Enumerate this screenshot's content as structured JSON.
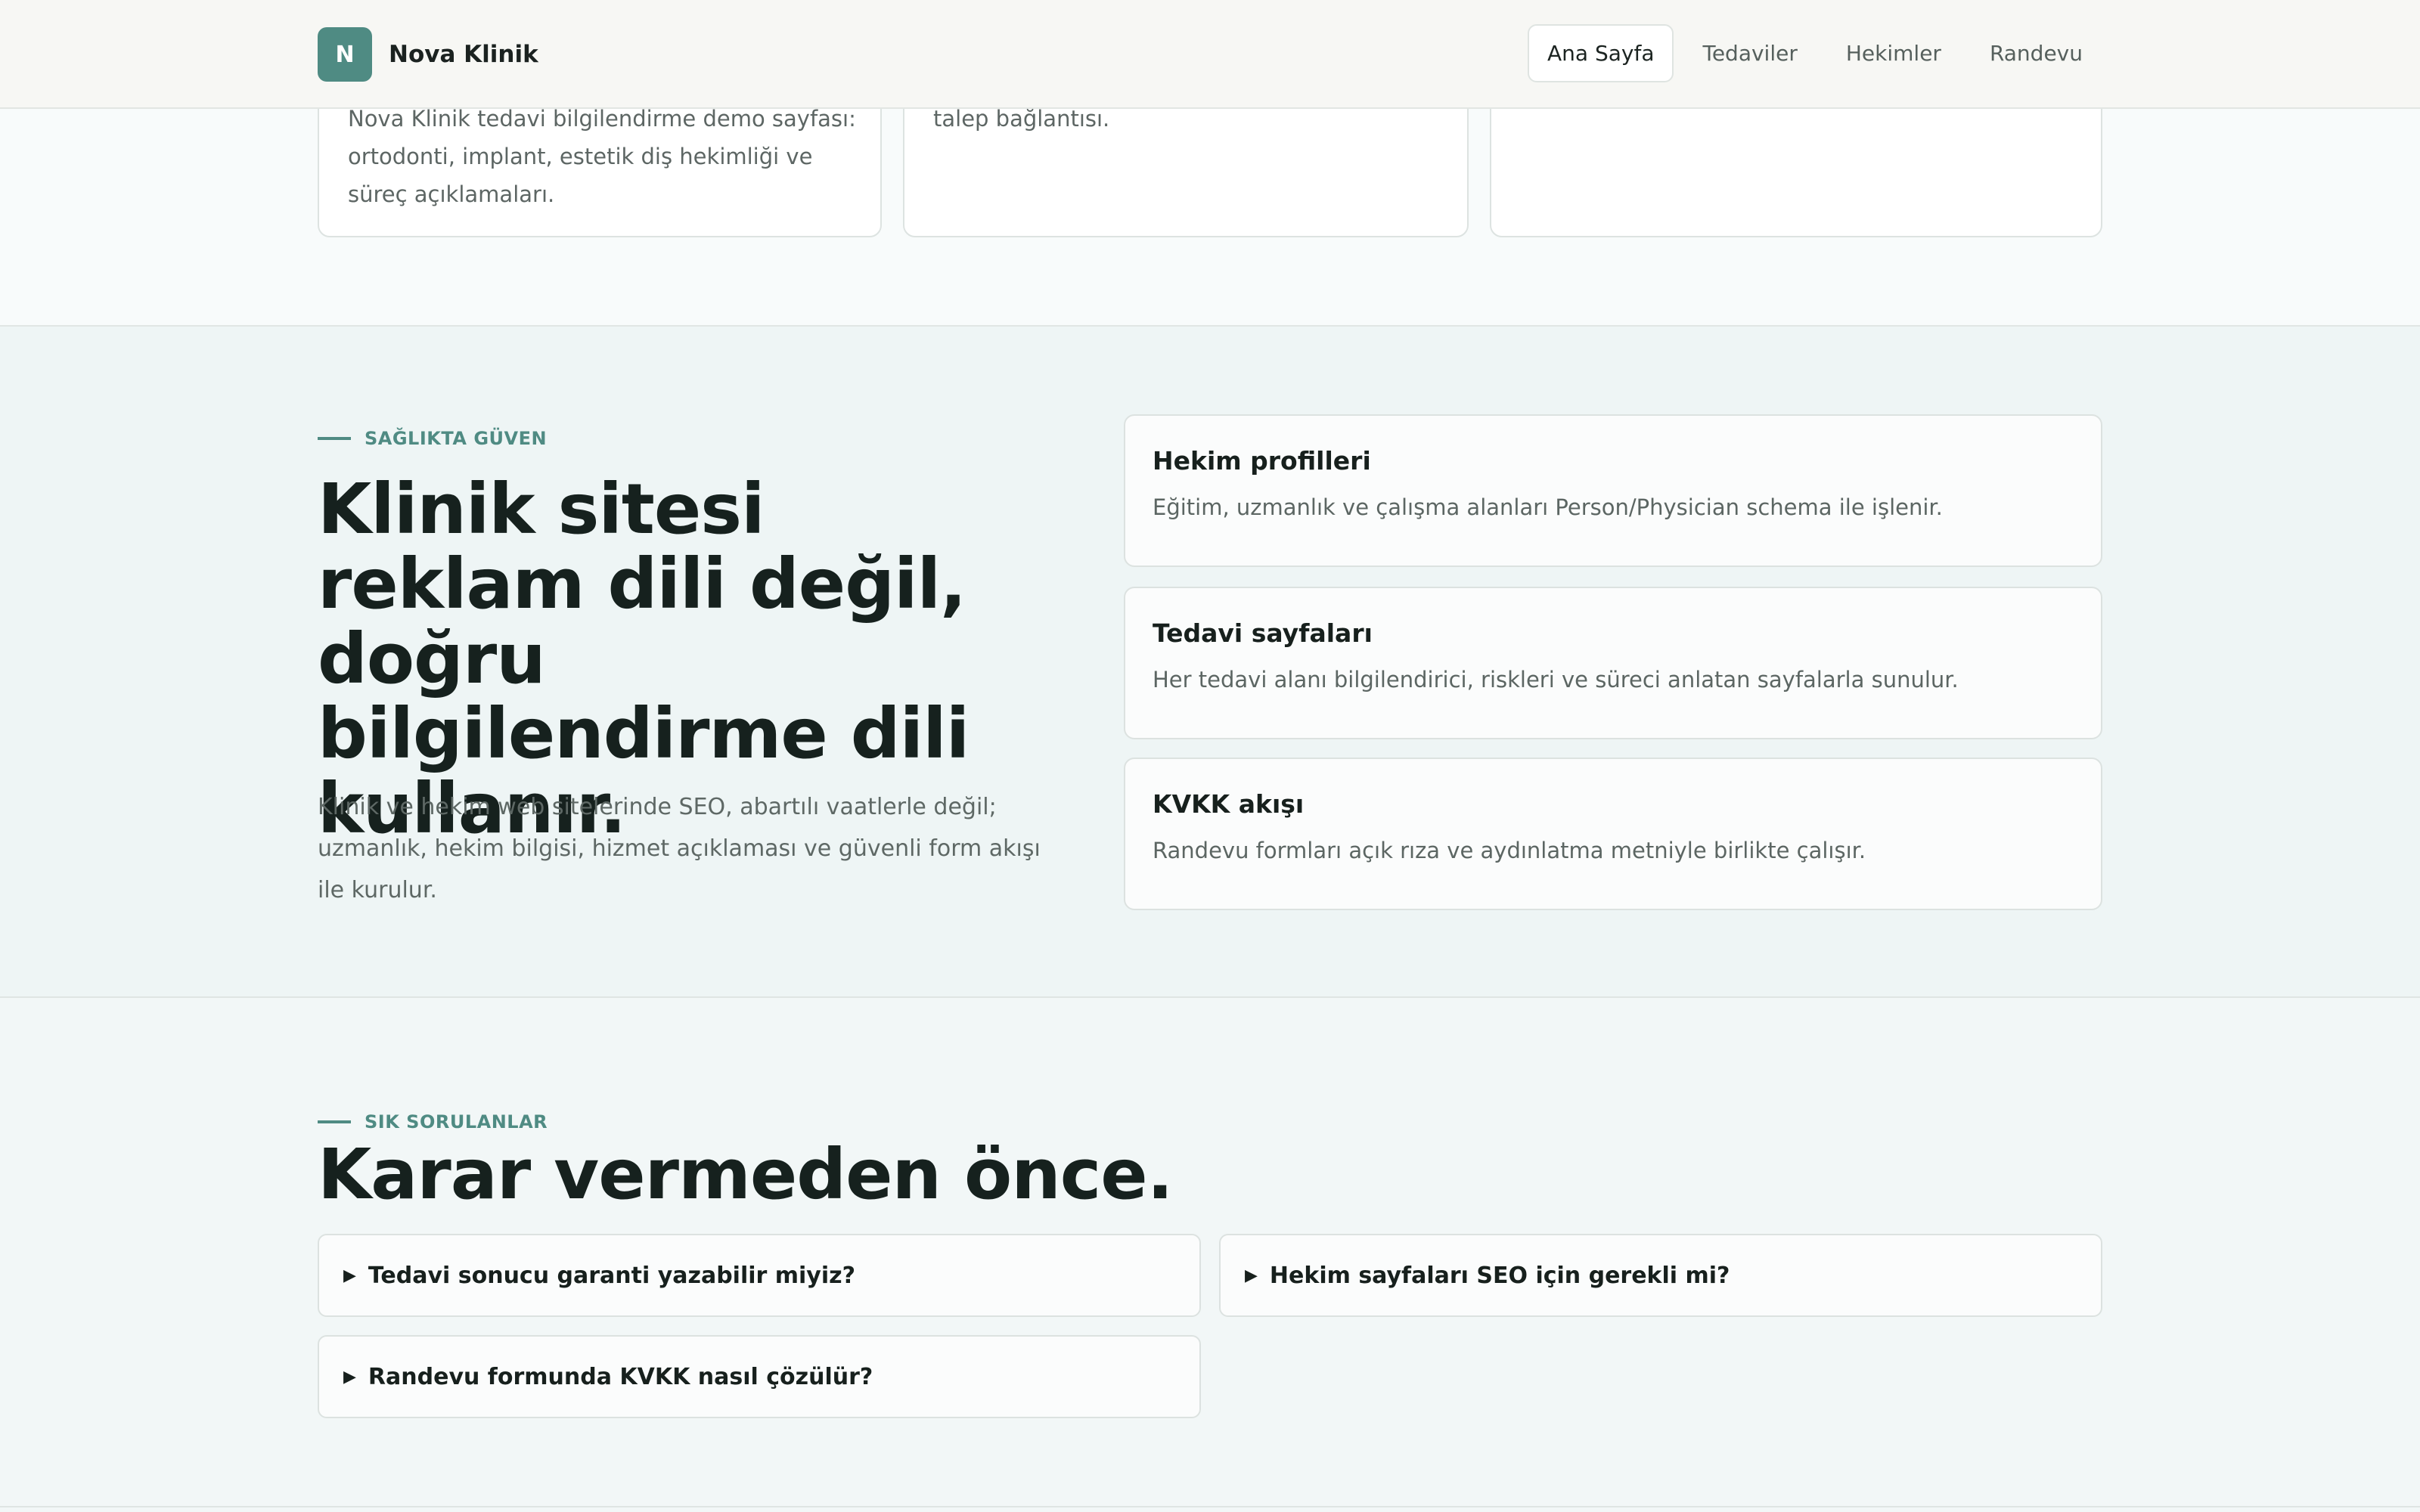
{
  "header": {
    "logo_letter": "N",
    "brand": "Nova Klinik",
    "nav": [
      {
        "label": "Ana Sayfa",
        "active": true
      },
      {
        "label": "Tedaviler"
      },
      {
        "label": "Hekimler"
      },
      {
        "label": "Randevu"
      }
    ]
  },
  "top_cards": [
    {
      "text_lines": [
        "Nova Klinik tedavi bilgilendirme demo sayfası:",
        "ortodonti, implant, estetik diş hekimliği ve",
        "süreç açıklamaları."
      ]
    },
    {
      "text_lines": [
        "talep bağlantısı."
      ]
    },
    {
      "text_lines": []
    }
  ],
  "trust": {
    "eyebrow": "SAĞLIKTA GÜVEN",
    "title": "Klinik sitesi reklam dili değil, doğru bilgilendirme dili kullanır.",
    "lead": "Klinik ve hekim web sitelerinde SEO, abartılı vaatlerle değil; uzmanlık, hekim bilgisi, hizmet açıklaması ve güvenli form akışı ile kurulur.",
    "features": [
      {
        "title": "Hekim profilleri",
        "desc": "Eğitim, uzmanlık ve çalışma alanları Person/Physician schema ile işlenir."
      },
      {
        "title": "Tedavi sayfaları",
        "desc": "Her tedavi alanı bilgilendirici, riskleri ve süreci anlatan sayfalarla sunulur."
      },
      {
        "title": "KVKK akışı",
        "desc": "Randevu formları açık rıza ve aydınlatma metniyle birlikte çalışır."
      }
    ]
  },
  "faq": {
    "eyebrow": "SIK SORULANLAR",
    "title": "Karar vermeden önce.",
    "questions": [
      "Tedavi sonucu garanti yazabilir miyiz?",
      "Hekim sayfaları SEO için gerekli mi?",
      "Randevu formunda KVKK nasıl çözülür?"
    ]
  },
  "colors": {
    "accent": "#4f8b83",
    "heading": "#16211e",
    "body_text": "#5e6865"
  }
}
